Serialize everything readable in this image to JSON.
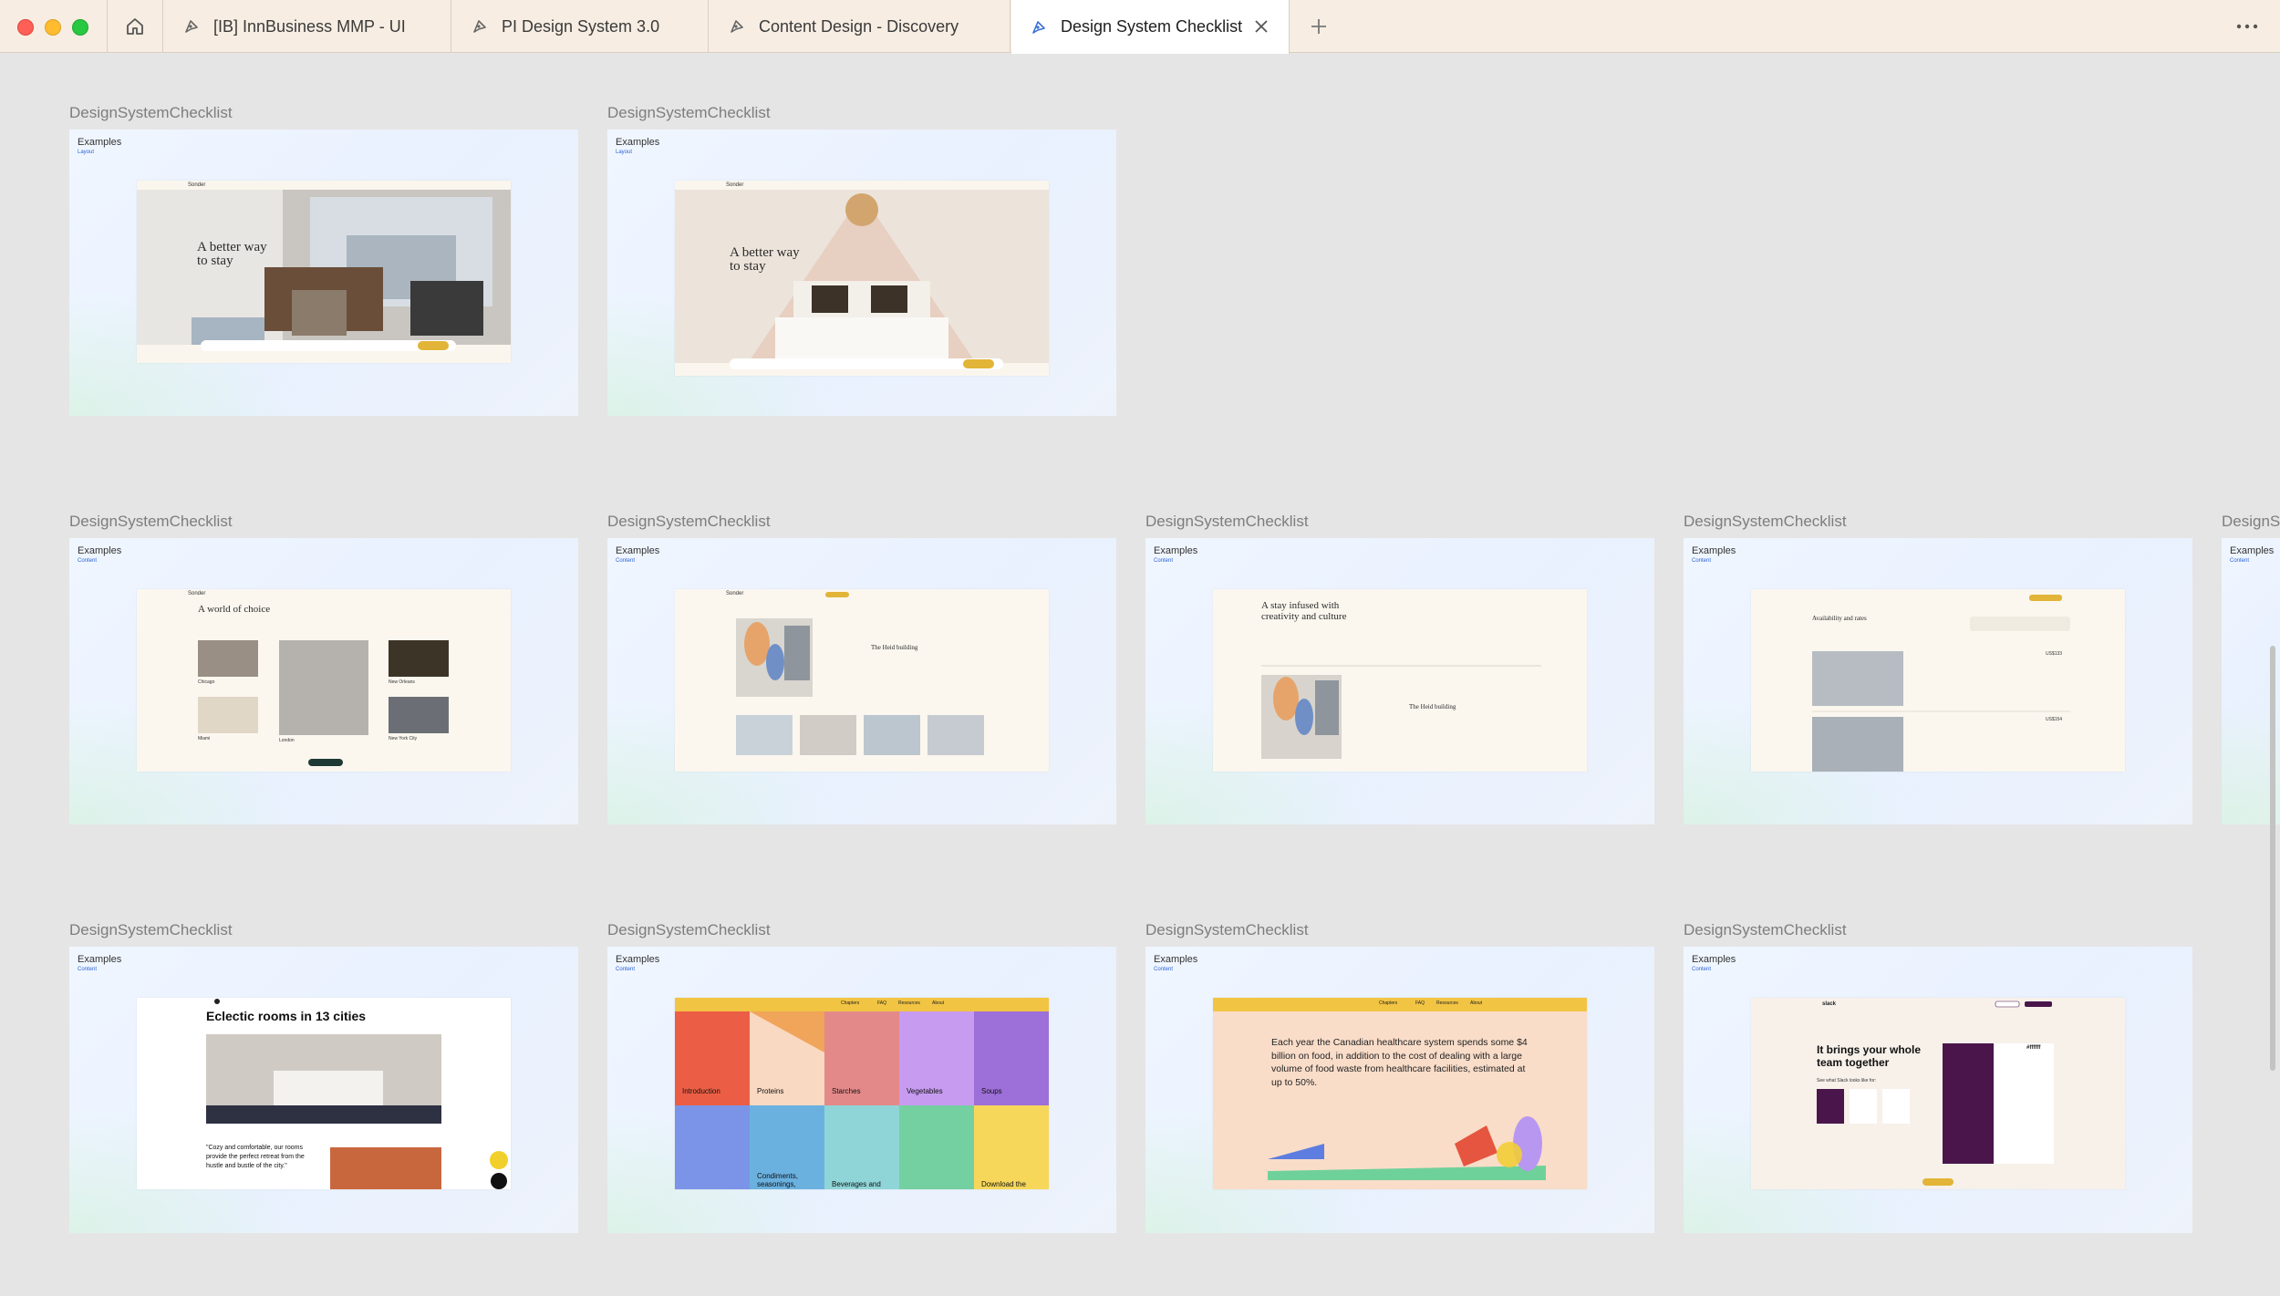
{
  "tabs": [
    {
      "label": "[IB] InnBusiness MMP - UI",
      "icon": "figma-file-icon"
    },
    {
      "label": "PI Design System 3.0",
      "icon": "figma-file-icon"
    },
    {
      "label": "Content Design - Discovery",
      "icon": "figma-file-icon"
    },
    {
      "label": "Design System Checklist",
      "icon": "figma-file-icon",
      "active": true
    }
  ],
  "frames": [
    {
      "label": "DesignSystemChecklist",
      "title": "Examples",
      "sub": "Layout"
    },
    {
      "label": "DesignSystemChecklist",
      "title": "Examples",
      "sub": "Layout"
    },
    {
      "label": "DesignSystemChecklist",
      "title": "Examples",
      "sub": "Content"
    },
    {
      "label": "DesignSystemChecklist",
      "title": "Examples",
      "sub": "Content"
    },
    {
      "label": "DesignSystemChecklist",
      "title": "Examples",
      "sub": "Content"
    },
    {
      "label": "DesignSystemChecklist",
      "title": "Examples",
      "sub": "Content"
    },
    {
      "label": "DesignSystemChecklist",
      "title": "Examples",
      "sub": "Content"
    },
    {
      "label": "DesignSystemChecklist",
      "title": "Examples",
      "sub": "Content"
    },
    {
      "label": "DesignSystemChecklist",
      "title": "Examples",
      "sub": "Content"
    },
    {
      "label": "DesignSystemChecklist",
      "title": "Examples",
      "sub": "Content"
    },
    {
      "label": "DesignSystemChecklist",
      "title": "Examples",
      "sub": "Content"
    }
  ],
  "partial_frame": {
    "label": "DesignS",
    "title": "Examples",
    "sub": "Content"
  },
  "shots": {
    "sonder_brand": "Sonder",
    "hero_headline": "A better way to stay",
    "world_title": "A world of choice",
    "world_cities": [
      "Chicago",
      "New Orleans",
      "Miami",
      "London",
      "New York City"
    ],
    "heid_title": "The Heid building",
    "culture_title": "A stay infused with creativity and culture",
    "availability_title": "Availability and rates",
    "rate_1": "US$133",
    "rate_2": "US$154",
    "eclectic_title": "Eclectic rooms in 13 cities",
    "eclectic_quote": "\"Cozy and comfortable, our rooms provide the perfect retreat from the hustle and bustle of the city.\"",
    "food_nav": [
      "Chapters",
      "FAQ",
      "Resources",
      "About"
    ],
    "food_tiles": [
      "Introduction",
      "Proteins",
      "Starches",
      "Vegetables",
      "Soups",
      "",
      "Condiments, seasonings,",
      "Beverages and",
      "",
      "Download the"
    ],
    "food_paragraph": "Each year the Canadian healthcare system spends some $4 billion on food, in addition to the cost of dealing with a large volume of food waste from healthcare facilities, estimated at up to 50%.",
    "slack_brand": "slack",
    "slack_headline": "It brings your whole team together",
    "slack_sub": "See what Slack looks like for:",
    "slack_channel": "#ffffff"
  },
  "colors": {
    "tabbar": "#f7ede2",
    "canvas": "#e5e5e5",
    "label": "#7d7d7d",
    "accent_yellow": "#f2c443",
    "link_blue": "#2c62d6"
  }
}
